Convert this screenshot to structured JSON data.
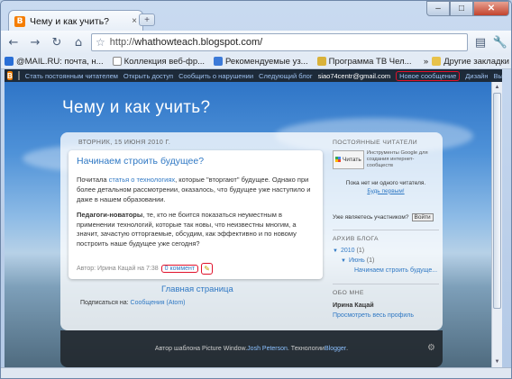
{
  "browser": {
    "tab_title": "Чему и как учить?",
    "tab_close": "×",
    "new_tab": "+",
    "win_min": "–",
    "win_max": "□",
    "win_close": "✕",
    "url_scheme": "http://",
    "url_host": "whathowteach.blogspot.com/",
    "bookmarks": [
      {
        "label": "@MAIL.RU: почта, н...",
        "color": "#2a6fd6"
      },
      {
        "label": "Коллекция веб-фр...",
        "color": "#3c7ad8"
      },
      {
        "label": "Рекомендуемые уз...",
        "color": "#3e9c3e"
      },
      {
        "label": "Программа ТВ Чел...",
        "color": "#d9b23a"
      }
    ],
    "bookmarks_more": "»",
    "other_bookmarks": "Другие закладки"
  },
  "navbar": {
    "logo": "B",
    "links": [
      "Стать постоянным читателем",
      "Открыть доступ",
      "Сообщить о нарушении",
      "Следующий блог"
    ],
    "email": "siao74centr@gmail.com",
    "new_post": "Новое сообщение",
    "design": "Дизайн",
    "logout": "Вы"
  },
  "blog": {
    "title": "Чему и как учить?",
    "date_header": "ВТОРНИК, 15 ИЮНЯ 2010 Г.",
    "post": {
      "title": "Начинаем строить будущее?",
      "p1_before": "Почитала ",
      "p1_link": "статья о технологиях",
      "p1_after": ", которые \"вторгают\" будущее. Однако при более детальном рассмотрении, оказалось, что будущее уже наступило и даже в нашем образовании.",
      "p2_bold": "Педагоги-новаторы",
      "p2_rest": ", те, кто не боится показаться неуместным в применении технологий, которые так новы, что неизвестны многим, а значит, зачастую отторгаемые, обсудим, как эффективно и по новому построить наше будущее уже сегодня?",
      "author_prefix": "Автор: Ирина Кацай на 7:38",
      "comments": "0 коммент",
      "edit_icon": "✎"
    },
    "home_link": "Главная страница",
    "subscribe_label": "Подписаться на:",
    "subscribe_link": "Сообщения (Atom)",
    "footer_prefix": "Автор шаблона Picture Window. ",
    "footer_author": "Josh Peterson",
    "footer_mid": ". Технологии ",
    "footer_blogger": "Blogger",
    "footer_end": "."
  },
  "sidebar": {
    "followers_h": "ПОСТОЯННЫЕ ЧИТАТЕЛИ",
    "follow_btn": "Читать",
    "gfc_text": "Инструменты Google для создания интернет-сообществ",
    "no_followers": "Пока нет ни одного читателя.",
    "be_first": "Будь первым!",
    "member_q": "Уже являетесь участником?",
    "login_btn": "Войти",
    "archive_h": "АРХИВ БЛОГА",
    "archive_year": "2010",
    "archive_year_cnt": "(1)",
    "archive_month": "Июнь",
    "archive_month_cnt": "(1)",
    "archive_post": "Начинаем строить будуще...",
    "about_h": "ОБО МНЕ",
    "about_name": "Ирина Кацай",
    "about_profile": "Просмотреть весь профиль"
  }
}
